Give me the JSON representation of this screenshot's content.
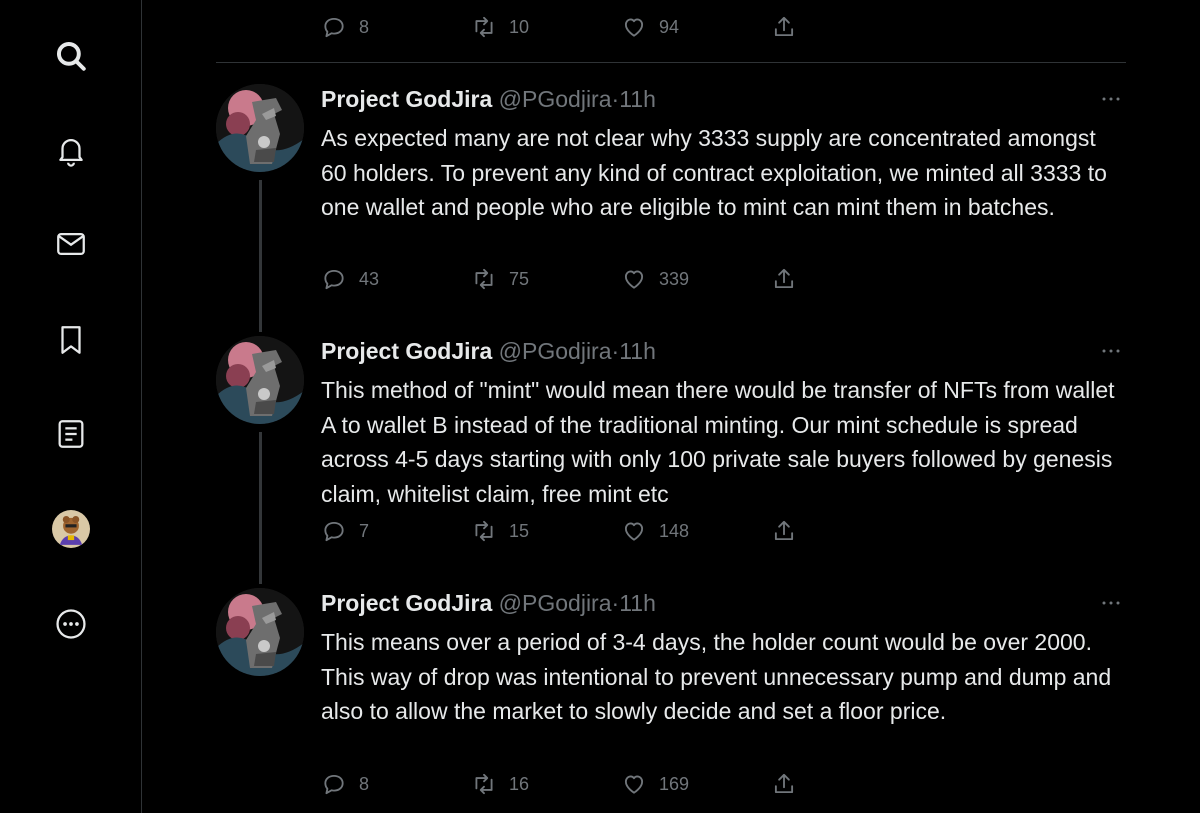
{
  "sidebar": {
    "items": [
      {
        "icon": "search-icon"
      },
      {
        "icon": "bell-icon"
      },
      {
        "icon": "mail-icon"
      },
      {
        "icon": "bookmark-icon"
      },
      {
        "icon": "lists-icon"
      },
      {
        "icon": "profile-avatar"
      },
      {
        "icon": "more-circle-icon"
      }
    ]
  },
  "top_tweet_actions": {
    "replies": "8",
    "retweets": "10",
    "likes": "94"
  },
  "tweets": [
    {
      "name": "Project GodJira",
      "handle": "@PGodjira",
      "sep": "·",
      "time": "11h",
      "text": "As expected many are not clear why 3333 supply are concentrated amongst 60 holders. To prevent any kind of contract exploitation, we minted all 3333 to one wallet and people who are eligible to mint can mint them in batches.",
      "replies": "43",
      "retweets": "75",
      "likes": "339"
    },
    {
      "name": "Project GodJira",
      "handle": "@PGodjira",
      "sep": "·",
      "time": "11h",
      "text": "This method of \"mint\" would mean there would be transfer of NFTs from wallet A to wallet B instead of the traditional minting. Our mint schedule is spread across 4-5 days starting with only 100 private sale buyers followed by genesis claim, whitelist claim, free mint etc",
      "replies": "7",
      "retweets": "15",
      "likes": "148"
    },
    {
      "name": "Project GodJira",
      "handle": "@PGodjira",
      "sep": "·",
      "time": "11h",
      "text": "This means over a period of 3-4 days, the holder count would be over 2000. This way of drop was intentional to prevent unnecessary pump and dump and also to allow the market to slowly decide and set a floor price.",
      "replies": "8",
      "retweets": "16",
      "likes": "169"
    }
  ],
  "colors": {
    "background": "#000000",
    "text": "#e7e9ea",
    "muted": "#71767b",
    "border": "#2f3336"
  }
}
